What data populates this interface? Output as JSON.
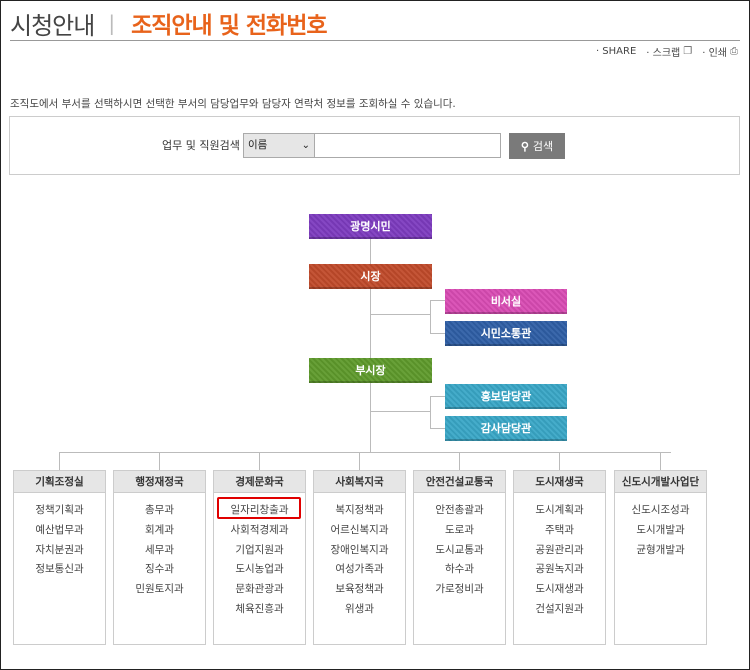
{
  "header": {
    "title": "시청안내",
    "separator": "|",
    "subtitle": "조직안내 및 전화번호"
  },
  "utility": {
    "share": "· SHARE",
    "scrap": "· 스크랩",
    "print": "· 인쇄"
  },
  "description": "조직도에서 부서를 선택하시면 선택한 부서의 담당업무와 담당자 연락처 정보를 조회하실 수 있습니다.",
  "search": {
    "label": "업무 및 직원검색",
    "select_value": "이름",
    "input_value": "",
    "button_label": "검색"
  },
  "org": {
    "citizens": "광명시민",
    "mayor": "시장",
    "secretary": "비서실",
    "communication": "시민소통관",
    "deputy_mayor": "부시장",
    "pr_officer": "홍보담당관",
    "audit_officer": "감사담당관"
  },
  "colors": {
    "citizens": "#7d3cbf",
    "mayor": "#c04a2a",
    "secretary": "#d94bb4",
    "communication": "#2f5fa6",
    "deputy_mayor": "#5f9a2c",
    "pr_officer": "#39a7c7",
    "audit_officer": "#39a7c7",
    "accent": "#e8631b",
    "highlight": "#e00000"
  },
  "departments": [
    {
      "name": "기획조정실",
      "items": [
        "정책기획과",
        "예산법무과",
        "자치분권과",
        "정보통신과"
      ]
    },
    {
      "name": "행정재정국",
      "items": [
        "총무과",
        "회계과",
        "세무과",
        "징수과",
        "민원토지과"
      ]
    },
    {
      "name": "경제문화국",
      "items": [
        "일자리창출과",
        "사회적경제과",
        "기업지원과",
        "도시농업과",
        "문화관광과",
        "체육진흥과"
      ]
    },
    {
      "name": "사회복지국",
      "items": [
        "복지정책과",
        "어르신복지과",
        "장애인복지과",
        "여성가족과",
        "보육정책과",
        "위생과"
      ]
    },
    {
      "name": "안전건설교통국",
      "items": [
        "안전총괄과",
        "도로과",
        "도시교통과",
        "하수과",
        "가로정비과"
      ]
    },
    {
      "name": "도시재생국",
      "items": [
        "도시계획과",
        "주택과",
        "공원관리과",
        "공원녹지과",
        "도시재생과",
        "건설지원과"
      ]
    },
    {
      "name": "신도시개발사업단",
      "items": [
        "신도시조성과",
        "도시개발과",
        "균형개발과"
      ]
    }
  ]
}
